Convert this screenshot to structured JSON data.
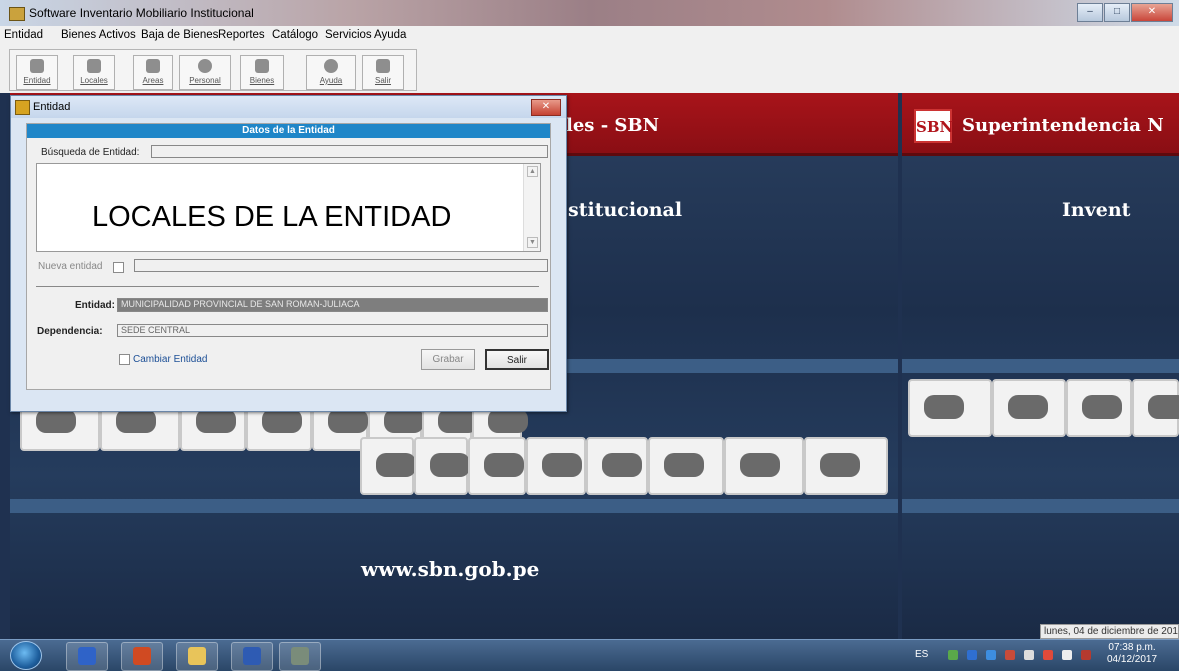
{
  "window": {
    "title": "Software Inventario Mobiliario Institucional"
  },
  "menu": [
    "Entidad",
    "Bienes Activos",
    "Baja de Bienes",
    "Reportes",
    "Catálogo",
    "Servicios",
    "Ayuda"
  ],
  "toolbar": {
    "entidad": "Entidad",
    "locales": "Locales",
    "areas": "Areas",
    "personal": "Personal",
    "bienes": "Bienes",
    "ayuda": "Ayuda",
    "salir": "Salir"
  },
  "background": {
    "banner1": "les - SBN",
    "banner2": "Superintendencia N",
    "logo": "SBN",
    "subtitle1": "stitucional",
    "subtitle2": "Invent",
    "website": "www.sbn.gob.pe",
    "date": "lunes, 04 de diciembre de 201"
  },
  "dialog": {
    "title": "Entidad",
    "header": "Datos de la Entidad",
    "search_label": "Búsqueda de Entidad:",
    "list_text": "LOCALES DE LA ENTIDAD",
    "new_entity_label": "Nueva entidad",
    "entity_label": "Entidad:",
    "entity_value": "MUNICIPALIDAD PROVINCIAL DE SAN ROMAN-JULIACA",
    "dependency_label": "Dependencia:",
    "dependency_value": "SEDE CENTRAL",
    "change_entity_label": "Cambiar Entidad",
    "save_label": "Grabar",
    "exit_label": "Salir"
  },
  "taskbar": {
    "language": "ES",
    "time": "07:38 p.m.",
    "date": "04/12/2017"
  },
  "colors": {
    "banner": "#a8141a",
    "dialog_header": "#1f86c8",
    "desktop": "#1f3150"
  }
}
